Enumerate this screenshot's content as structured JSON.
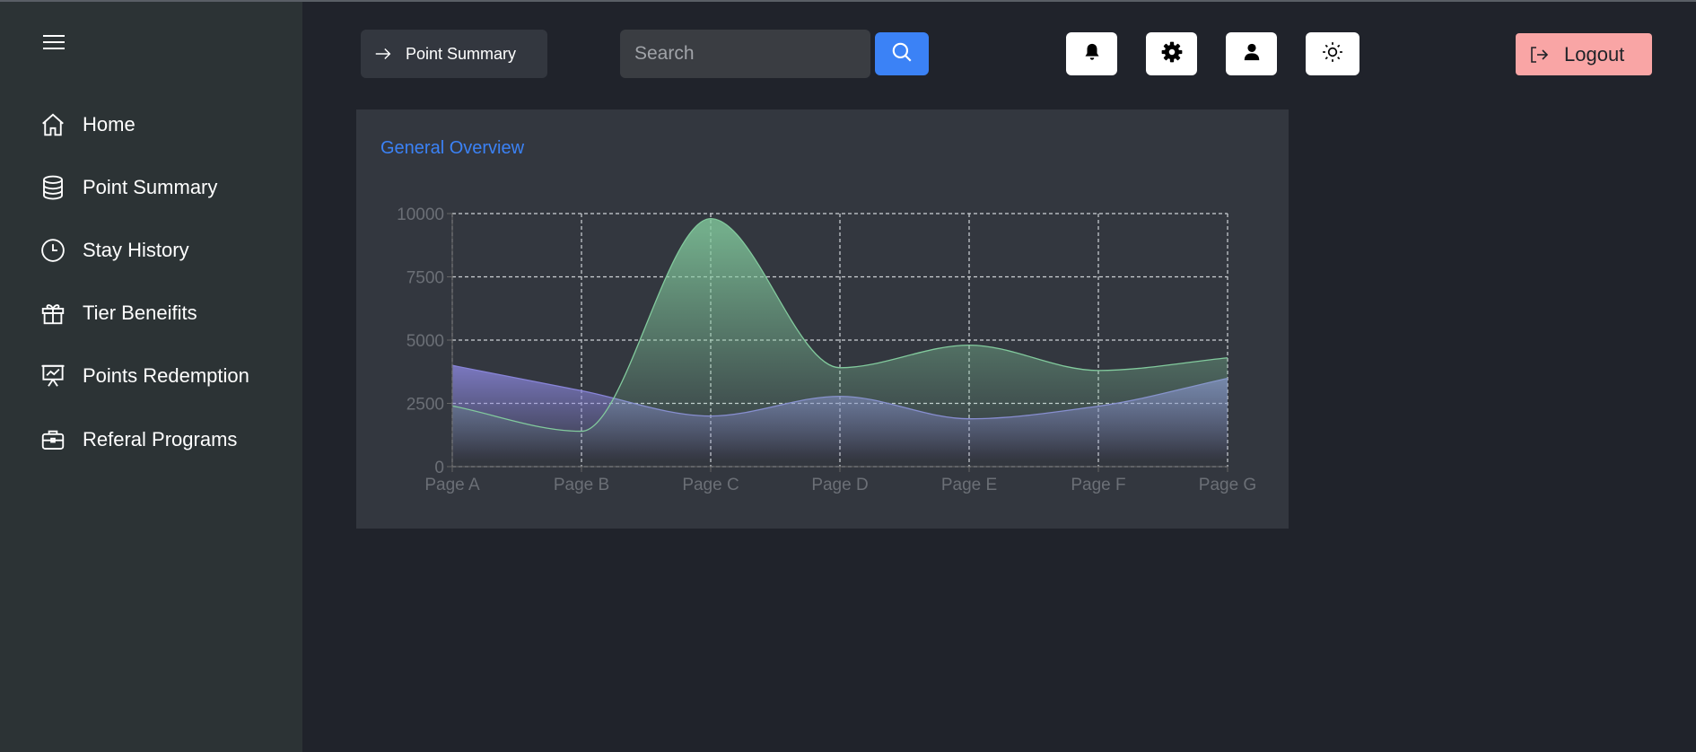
{
  "sidebar": {
    "items": [
      {
        "label": "Home",
        "icon": "home-icon"
      },
      {
        "label": "Point Summary",
        "icon": "database-icon"
      },
      {
        "label": "Stay History",
        "icon": "clock-icon"
      },
      {
        "label": "Tier Beneifits",
        "icon": "gift-icon"
      },
      {
        "label": "Points Redemption",
        "icon": "presentation-chart-icon"
      },
      {
        "label": "Referal Programs",
        "icon": "briefcase-icon"
      }
    ]
  },
  "header": {
    "breadcrumb": "Point Summary",
    "search_placeholder": "Search",
    "logout_label": "Logout"
  },
  "card": {
    "title": "General Overview"
  },
  "colors": {
    "accent": "#3b82f6",
    "series_green": "#82ca9d",
    "series_purple": "#8884d8",
    "logout": "#f9a5a5"
  },
  "chart_data": {
    "type": "area",
    "categories": [
      "Page A",
      "Page B",
      "Page C",
      "Page D",
      "Page E",
      "Page F",
      "Page G"
    ],
    "series": [
      {
        "values": [
          4000,
          3000,
          2000,
          2780,
          1890,
          2390,
          3490
        ],
        "color": "#8884d8"
      },
      {
        "values": [
          2400,
          1398,
          9800,
          3908,
          4800,
          3800,
          4300
        ],
        "color": "#82ca9d"
      }
    ],
    "yticks": [
      0,
      2500,
      5000,
      7500,
      10000
    ],
    "ylim": [
      0,
      10000
    ],
    "grid": true
  }
}
